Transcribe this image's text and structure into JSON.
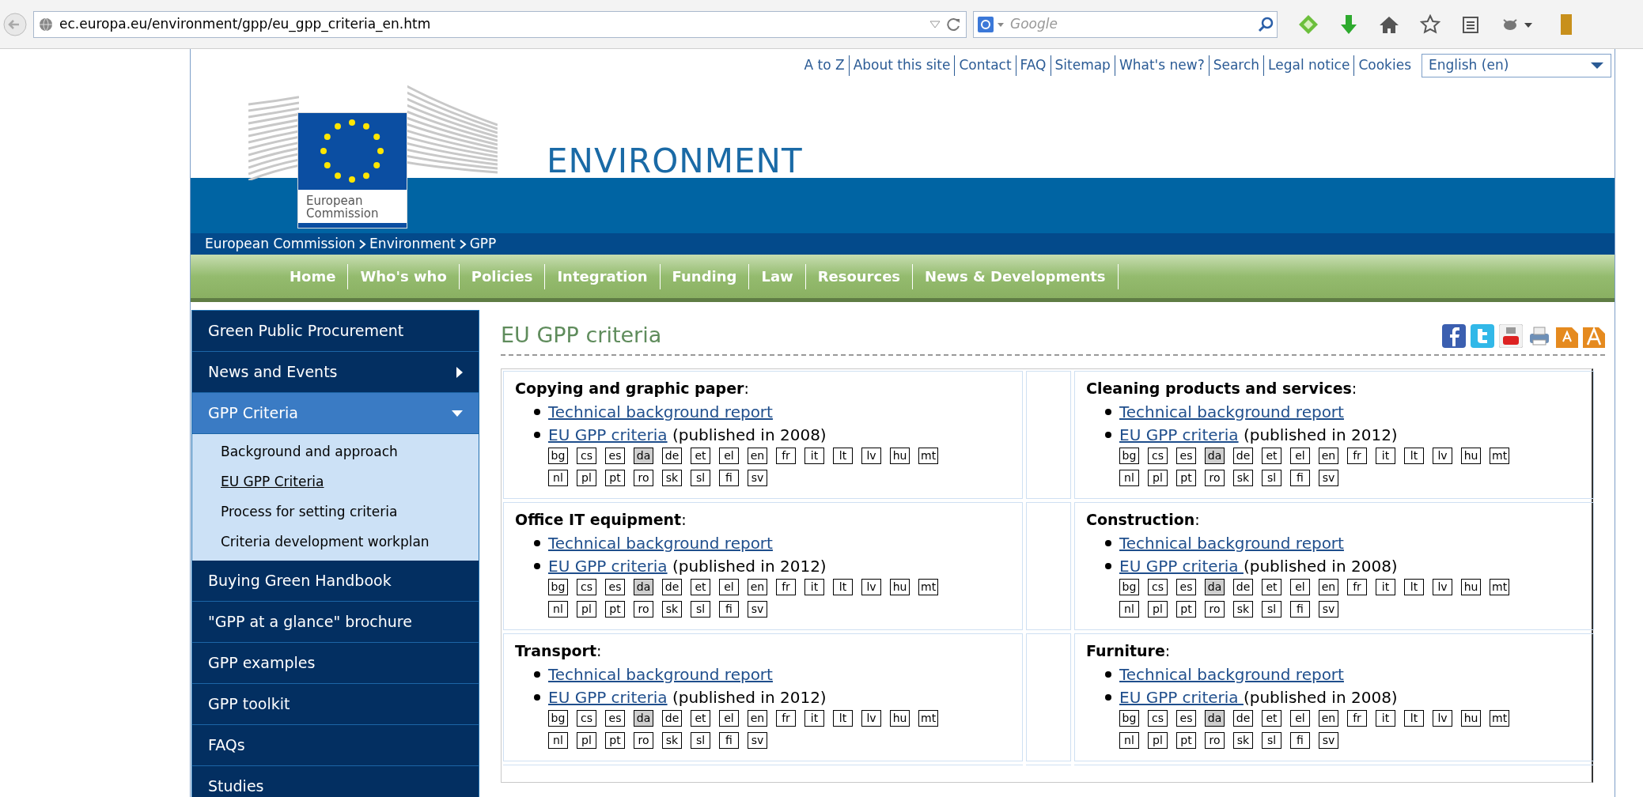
{
  "browser": {
    "url": "ec.europa.eu/environment/gpp/eu_gpp_criteria_en.htm",
    "search": {
      "placeholder": "Google"
    }
  },
  "header": {
    "top_links": [
      "A to Z",
      "About this site",
      "Contact",
      "FAQ",
      "Sitemap",
      "What's new?",
      "Search",
      "Legal notice",
      "Cookies"
    ],
    "language_select": {
      "value": "English (en)"
    },
    "logo_lines": [
      "European",
      "Commission"
    ],
    "site_title": "ENVIRONMENT"
  },
  "breadcrumb": [
    "European Commission",
    "Environment",
    "GPP"
  ],
  "nav": [
    "Home",
    "Who's who",
    "Policies",
    "Integration",
    "Funding",
    "Law",
    "Resources",
    "News & Developments"
  ],
  "sidebar": {
    "items": [
      {
        "label": "Green Public Procurement",
        "kind": "link",
        "selected": false
      },
      {
        "label": "News and Events",
        "kind": "menu",
        "expanded": false,
        "selected": false
      },
      {
        "label": "GPP Criteria",
        "kind": "menu",
        "expanded": true,
        "selected": true,
        "children": [
          {
            "label": "Background and approach",
            "selected": false
          },
          {
            "label": "EU GPP Criteria",
            "selected": true
          },
          {
            "label": "Process for setting criteria",
            "selected": false
          },
          {
            "label": "Criteria development workplan",
            "selected": false
          }
        ]
      },
      {
        "label": "Buying Green Handbook",
        "kind": "link",
        "selected": false
      },
      {
        "label": "\"GPP at a glance\" brochure",
        "kind": "link",
        "selected": false
      },
      {
        "label": "GPP examples",
        "kind": "link",
        "selected": false
      },
      {
        "label": "GPP toolkit",
        "kind": "link",
        "selected": false
      },
      {
        "label": "FAQs",
        "kind": "link",
        "selected": false
      },
      {
        "label": "Studies",
        "kind": "link",
        "selected": false
      }
    ]
  },
  "content": {
    "title": "EU GPP criteria",
    "categories": [
      {
        "title": "**Copying and graphic paper**:",
        "links": [
          {
            "text": "Technical background report"
          },
          {
            "text": "EU GPP criteria",
            "note": "(published in 2008)"
          }
        ],
        "languages": [
          {
            "code": "bg",
            "disabled": false
          },
          {
            "code": "cs",
            "disabled": false
          },
          {
            "code": "es",
            "disabled": false
          },
          {
            "code": "da",
            "disabled": true
          },
          {
            "code": "de",
            "disabled": false
          },
          {
            "code": "et",
            "disabled": false
          },
          {
            "code": "el",
            "disabled": false
          },
          {
            "code": "en",
            "disabled": false
          },
          {
            "code": "fr",
            "disabled": false
          },
          {
            "code": "it",
            "disabled": false
          },
          {
            "code": "lt",
            "disabled": false
          },
          {
            "code": "lv",
            "disabled": false
          },
          {
            "code": "hu",
            "disabled": false
          },
          {
            "code": "mt",
            "disabled": false
          },
          {
            "code": "nl",
            "disabled": false
          },
          {
            "code": "pl",
            "disabled": false
          },
          {
            "code": "pt",
            "disabled": false
          },
          {
            "code": "ro",
            "disabled": false
          },
          {
            "code": "sk",
            "disabled": false
          },
          {
            "code": "sl",
            "disabled": false
          },
          {
            "code": "fi",
            "disabled": false
          },
          {
            "code": "sv",
            "disabled": false
          }
        ]
      },
      {
        "title": "**Cleaning products and services**:",
        "links": [
          {
            "text": "Technical background report"
          },
          {
            "text": "EU GPP criteria",
            "note": "(published in 2012)"
          }
        ],
        "languages": [
          {
            "code": "bg",
            "disabled": false
          },
          {
            "code": "cs",
            "disabled": false
          },
          {
            "code": "es",
            "disabled": false
          },
          {
            "code": "da",
            "disabled": true
          },
          {
            "code": "de",
            "disabled": false
          },
          {
            "code": "et",
            "disabled": false
          },
          {
            "code": "el",
            "disabled": false
          },
          {
            "code": "en",
            "disabled": false
          },
          {
            "code": "fr",
            "disabled": false
          },
          {
            "code": "it",
            "disabled": false
          },
          {
            "code": "lt",
            "disabled": false
          },
          {
            "code": "lv",
            "disabled": false
          },
          {
            "code": "hu",
            "disabled": false
          },
          {
            "code": "mt",
            "disabled": false
          },
          {
            "code": "nl",
            "disabled": false
          },
          {
            "code": "pl",
            "disabled": false
          },
          {
            "code": "pt",
            "disabled": false
          },
          {
            "code": "ro",
            "disabled": false
          },
          {
            "code": "sk",
            "disabled": false
          },
          {
            "code": "sl",
            "disabled": false
          },
          {
            "code": "fi",
            "disabled": false
          },
          {
            "code": "sv",
            "disabled": false
          }
        ]
      },
      {
        "title": "**Office IT equipment**:",
        "links": [
          {
            "text": "Technical background report"
          },
          {
            "text": "EU GPP criteria",
            "note": "(published in 2012)"
          }
        ],
        "languages": [
          {
            "code": "bg",
            "disabled": false
          },
          {
            "code": "cs",
            "disabled": false
          },
          {
            "code": "es",
            "disabled": false
          },
          {
            "code": "da",
            "disabled": true
          },
          {
            "code": "de",
            "disabled": false
          },
          {
            "code": "et",
            "disabled": false
          },
          {
            "code": "el",
            "disabled": false
          },
          {
            "code": "en",
            "disabled": false
          },
          {
            "code": "fr",
            "disabled": false
          },
          {
            "code": "it",
            "disabled": false
          },
          {
            "code": "lt",
            "disabled": false
          },
          {
            "code": "lv",
            "disabled": false
          },
          {
            "code": "hu",
            "disabled": false
          },
          {
            "code": "mt",
            "disabled": false
          },
          {
            "code": "nl",
            "disabled": false
          },
          {
            "code": "pl",
            "disabled": false
          },
          {
            "code": "pt",
            "disabled": false
          },
          {
            "code": "ro",
            "disabled": false
          },
          {
            "code": "sk",
            "disabled": false
          },
          {
            "code": "sl",
            "disabled": false
          },
          {
            "code": "fi",
            "disabled": false
          },
          {
            "code": "sv",
            "disabled": false
          }
        ]
      },
      {
        "title": "**Construction**:",
        "links": [
          {
            "text": "Technical background report"
          },
          {
            "text": "EU GPP criteria ",
            "note": "(published in 2008)"
          }
        ],
        "languages": [
          {
            "code": "bg",
            "disabled": false
          },
          {
            "code": "cs",
            "disabled": false
          },
          {
            "code": "es",
            "disabled": false
          },
          {
            "code": "da",
            "disabled": true
          },
          {
            "code": "de",
            "disabled": false
          },
          {
            "code": "et",
            "disabled": false
          },
          {
            "code": "el",
            "disabled": false
          },
          {
            "code": "en",
            "disabled": false
          },
          {
            "code": "fr",
            "disabled": false
          },
          {
            "code": "it",
            "disabled": false
          },
          {
            "code": "lt",
            "disabled": false
          },
          {
            "code": "lv",
            "disabled": false
          },
          {
            "code": "hu",
            "disabled": false
          },
          {
            "code": "mt",
            "disabled": false
          },
          {
            "code": "nl",
            "disabled": false
          },
          {
            "code": "pl",
            "disabled": false
          },
          {
            "code": "pt",
            "disabled": false
          },
          {
            "code": "ro",
            "disabled": false
          },
          {
            "code": "sk",
            "disabled": false
          },
          {
            "code": "sl",
            "disabled": false
          },
          {
            "code": "fi",
            "disabled": false
          },
          {
            "code": "sv",
            "disabled": false
          }
        ]
      },
      {
        "title": "**Transport**:",
        "links": [
          {
            "text": "Technical background report"
          },
          {
            "text": "EU GPP criteria",
            "note": "(published in 2012)"
          }
        ],
        "languages": [
          {
            "code": "bg",
            "disabled": false
          },
          {
            "code": "cs",
            "disabled": false
          },
          {
            "code": "es",
            "disabled": false
          },
          {
            "code": "da",
            "disabled": true
          },
          {
            "code": "de",
            "disabled": false
          },
          {
            "code": "et",
            "disabled": false
          },
          {
            "code": "el",
            "disabled": false
          },
          {
            "code": "en",
            "disabled": false
          },
          {
            "code": "fr",
            "disabled": false
          },
          {
            "code": "it",
            "disabled": false
          },
          {
            "code": "lt",
            "disabled": false
          },
          {
            "code": "lv",
            "disabled": false
          },
          {
            "code": "hu",
            "disabled": false
          },
          {
            "code": "mt",
            "disabled": false
          },
          {
            "code": "nl",
            "disabled": false
          },
          {
            "code": "pl",
            "disabled": false
          },
          {
            "code": "pt",
            "disabled": false
          },
          {
            "code": "ro",
            "disabled": false
          },
          {
            "code": "sk",
            "disabled": false
          },
          {
            "code": "sl",
            "disabled": false
          },
          {
            "code": "fi",
            "disabled": false
          },
          {
            "code": "sv",
            "disabled": false
          }
        ]
      },
      {
        "title": "**Furniture**:",
        "links": [
          {
            "text": "Technical background report"
          },
          {
            "text": "EU GPP criteria ",
            "note": "(published in 2008)"
          }
        ],
        "languages": [
          {
            "code": "bg",
            "disabled": false
          },
          {
            "code": "cs",
            "disabled": false
          },
          {
            "code": "es",
            "disabled": false
          },
          {
            "code": "da",
            "disabled": true
          },
          {
            "code": "de",
            "disabled": false
          },
          {
            "code": "et",
            "disabled": false
          },
          {
            "code": "el",
            "disabled": false
          },
          {
            "code": "en",
            "disabled": false
          },
          {
            "code": "fr",
            "disabled": false
          },
          {
            "code": "it",
            "disabled": false
          },
          {
            "code": "lt",
            "disabled": false
          },
          {
            "code": "lv",
            "disabled": false
          },
          {
            "code": "hu",
            "disabled": false
          },
          {
            "code": "mt",
            "disabled": false
          },
          {
            "code": "nl",
            "disabled": false
          },
          {
            "code": "pl",
            "disabled": false
          },
          {
            "code": "pt",
            "disabled": false
          },
          {
            "code": "ro",
            "disabled": false
          },
          {
            "code": "sk",
            "disabled": false
          },
          {
            "code": "sl",
            "disabled": false
          },
          {
            "code": "fi",
            "disabled": false
          },
          {
            "code": "sv",
            "disabled": false
          }
        ]
      }
    ]
  }
}
